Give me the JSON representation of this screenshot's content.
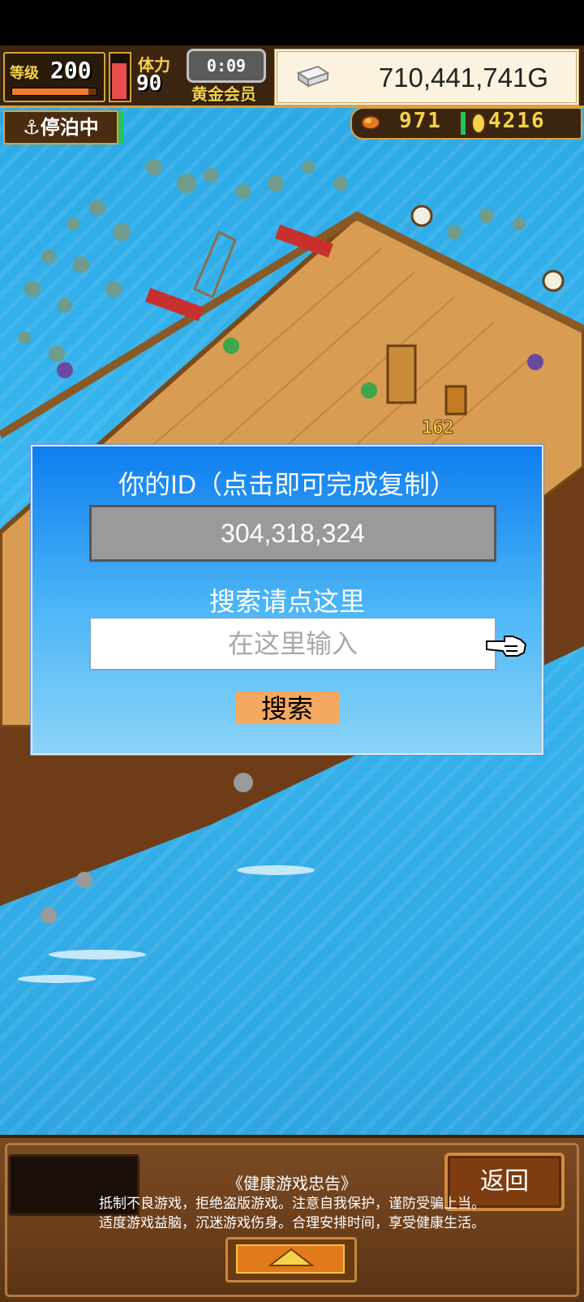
{
  "hud": {
    "level_label": "等级",
    "level_value": "200",
    "level_progress_fraction": 0.9,
    "stamina_label": "体力",
    "stamina_value": "90",
    "stamina_fill_fraction": 0.85,
    "timer": "0:09",
    "membership": "黄金会员",
    "gold_amount": "710,441,741G",
    "docked_status": "停泊中",
    "resource_food": "971",
    "resource_medal": "4216"
  },
  "scene": {
    "floating_number": "162"
  },
  "dialog": {
    "title": "你的ID（点击即可完成复制）",
    "player_id": "304,318,324",
    "search_prompt": "搜索请点这里",
    "search_placeholder": "在这里输入",
    "search_button": "搜索"
  },
  "bottom": {
    "back_button": "返回",
    "health_title": "《健康游戏忠告》",
    "health_line1": "抵制不良游戏，拒绝盗版游戏。注意自我保护，谨防受骗上当。",
    "health_line2": "适度游戏益脑，沉迷游戏伤身。合理安排时间，享受健康生活。"
  },
  "colors": {
    "hud_gold": "#f6d24a",
    "dialog_top": "#0e7ef0",
    "search_button": "#f3a95f",
    "back_button": "#7e3d10"
  }
}
